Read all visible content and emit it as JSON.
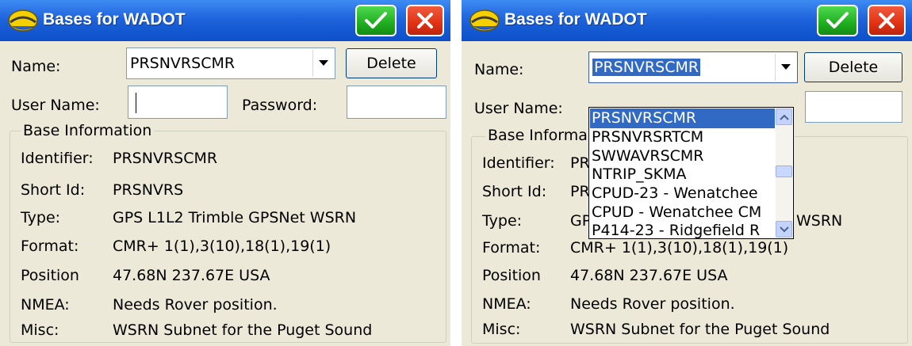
{
  "panels": [
    {
      "title": "Bases for WADOT",
      "name_label": "Name:",
      "name_value": "PRSNVRSCMR",
      "delete_label": "Delete",
      "username_label": "User Name:",
      "username_value": "",
      "password_label": "Password:",
      "password_value": "",
      "group_title": "Base Information",
      "info": [
        {
          "label": "Identifier:",
          "value": "PRSNVRSCMR"
        },
        {
          "label": "Short Id:",
          "value": "PRSNVRS"
        },
        {
          "label": "Type:",
          "value": "GPS L1L2 Trimble GPSNet WSRN"
        },
        {
          "label": "Format:",
          "value": "CMR+ 1(1),3(10),18(1),19(1)"
        },
        {
          "label": "Position",
          "value": "47.68N 237.67E USA"
        },
        {
          "label": "NMEA:",
          "value": "Needs Rover position."
        },
        {
          "label": "Misc:",
          "value": "WSRN Subnet for the Puget Sound"
        }
      ]
    },
    {
      "title": "Bases for WADOT",
      "name_label": "Name:",
      "name_value": "PRSNVRSCMR",
      "delete_label": "Delete",
      "username_label": "User Name:",
      "password_value": "",
      "group_title": "Base Informa",
      "info": [
        {
          "label": "Identifier:",
          "value": "PR"
        },
        {
          "label": "Short Id:",
          "value": "PR"
        },
        {
          "label": "Type:",
          "value": "GP",
          "value_tail": "WSRN"
        },
        {
          "label": "Format:",
          "value": "CMR+ 1(1),3(10),18(1),19(1)"
        },
        {
          "label": "Position",
          "value": "47.68N 237.67E USA"
        },
        {
          "label": "NMEA:",
          "value": "Needs Rover position."
        },
        {
          "label": "Misc:",
          "value": "WSRN Subnet for the Puget Sound"
        }
      ],
      "dropdown_options": [
        "PRSNVRSCMR",
        "PRSNVRSRTCM",
        "SWWAVRSCMR",
        "NTRIP_SKMA",
        "CPUD-23 - Wenatchee",
        "CPUD - Wenatchee CM",
        "P414-23 - Ridgefield R"
      ]
    }
  ],
  "icons": {
    "app": "survey-helmet-icon",
    "ok": "checkmark-icon",
    "close": "close-x-icon",
    "dropdown_arrow": "chevron-down-icon"
  },
  "colors": {
    "titlebar": "#1f64dc",
    "ok_button": "#1fae1f",
    "close_button": "#e03214",
    "selection": "#316ac5",
    "window_bg": "#ece9d8"
  }
}
